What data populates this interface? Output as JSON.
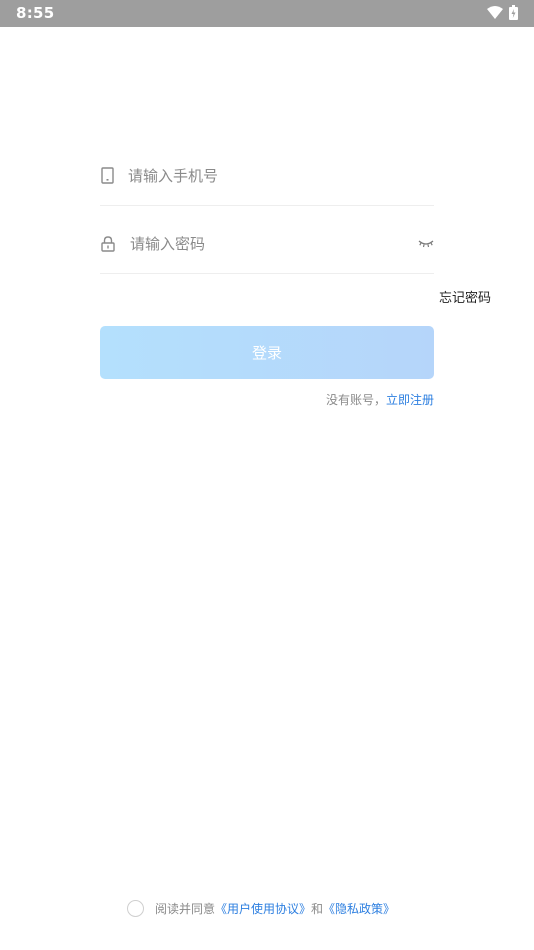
{
  "status_bar": {
    "time": "8:55",
    "icons": [
      "wifi-icon",
      "battery-icon"
    ]
  },
  "login_form": {
    "phone_placeholder": "请输入手机号",
    "phone_value": "",
    "password_placeholder": "请输入密码",
    "password_value": "",
    "forgot_password": "忘记密码",
    "login_button": "登录",
    "no_account_text": "没有账号，",
    "register_link": "立即注册"
  },
  "agreement": {
    "checked": false,
    "prefix": "阅读并同意",
    "user_agreement": "《用户使用协议》",
    "and": "和",
    "privacy_policy": "《隐私政策》"
  },
  "colors": {
    "status_bar": "#9e9e9e",
    "link": "#2d7fe0",
    "button_start": "#b4e0fd",
    "button_end": "#b5d5fa"
  }
}
